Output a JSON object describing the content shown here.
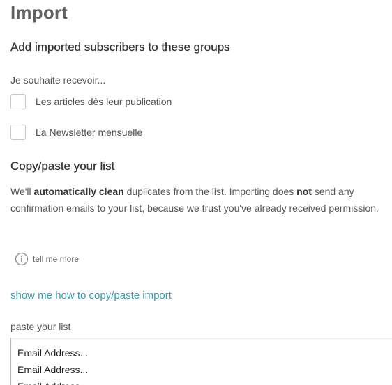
{
  "page": {
    "title": "Import"
  },
  "groups_section": {
    "heading": "Add imported subscribers to these groups",
    "label": "Je souhaite recevoir...",
    "options": [
      {
        "label": "Les articles dès leur publication",
        "checked": false
      },
      {
        "label": "La Newsletter mensuelle",
        "checked": false
      }
    ]
  },
  "copy_section": {
    "heading": "Copy/paste your list",
    "description": {
      "part1": "We'll ",
      "bold1": "automatically clean",
      "part2": " duplicates from the list. Importing does ",
      "bold2": "not",
      "part3": " send any confirmation emails to your list, because we trust you've already received permission."
    },
    "tell_more": {
      "icon": "info-icon",
      "label": "tell me more"
    },
    "show_link": "show me how to copy/paste import",
    "paste_label": "paste your list",
    "paste_lines": [
      "Email Address...",
      "Email Address...",
      "Email Address..."
    ]
  },
  "colors": {
    "link": "#3a9bb0",
    "title": "#606060",
    "checkbox_border": "#c8c8c8"
  }
}
